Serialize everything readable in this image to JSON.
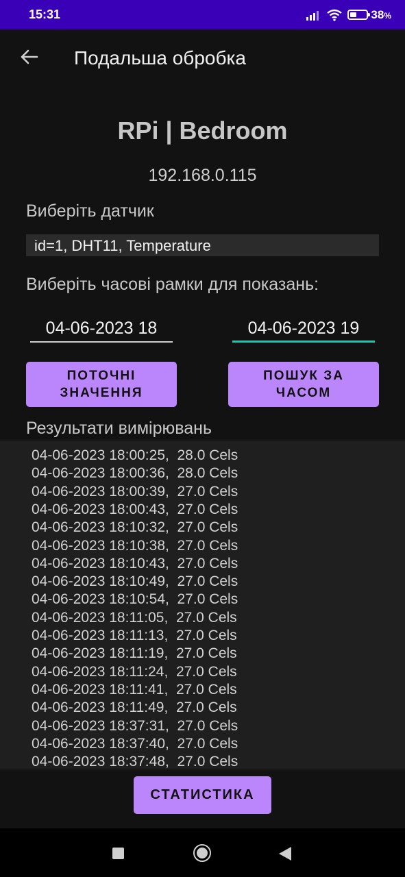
{
  "status_bar": {
    "time": "15:31",
    "battery_percent": "38",
    "battery_unit": "%",
    "battery_level": 0.38,
    "icons": [
      "signal-icon",
      "wifi-icon",
      "battery-icon"
    ]
  },
  "toolbar": {
    "back_icon": "arrow-left-icon",
    "title": "Подальша обробка"
  },
  "device": {
    "name": "RPi | Bedroom",
    "ip": "192.168.0.115"
  },
  "sensor": {
    "label": "Виберіть датчик",
    "selected": "id=1, DHT11, Temperature"
  },
  "timeframe": {
    "label": "Виберіть часові рамки для показань:",
    "from": "04-06-2023 18",
    "to": "04-06-2023 19"
  },
  "buttons": {
    "current_line1": "ПОТОЧНІ",
    "current_line2": "ЗНАЧЕННЯ",
    "search_line1": "ПОШУК ЗА",
    "search_line2": "ЧАСОМ",
    "stats": "СТАТИСТИКА"
  },
  "results": {
    "label": "Результати вимірювань",
    "rows": [
      "04-06-2023 18:00:25,  28.0 Cels",
      "04-06-2023 18:00:36,  28.0 Cels",
      "04-06-2023 18:00:39,  27.0 Cels",
      "04-06-2023 18:00:43,  27.0 Cels",
      "04-06-2023 18:10:32,  27.0 Cels",
      "04-06-2023 18:10:38,  27.0 Cels",
      "04-06-2023 18:10:43,  27.0 Cels",
      "04-06-2023 18:10:49,  27.0 Cels",
      "04-06-2023 18:10:54,  27.0 Cels",
      "04-06-2023 18:11:05,  27.0 Cels",
      "04-06-2023 18:11:13,  27.0 Cels",
      "04-06-2023 18:11:19,  27.0 Cels",
      "04-06-2023 18:11:24,  27.0 Cels",
      "04-06-2023 18:11:41,  27.0 Cels",
      "04-06-2023 18:11:49,  27.0 Cels",
      "04-06-2023 18:37:31,  27.0 Cels",
      "04-06-2023 18:37:40,  27.0 Cels",
      "04-06-2023 18:37:48,  27.0 Cels"
    ]
  },
  "nav_bar": {
    "icons": [
      "recents-square-icon",
      "home-circle-icon",
      "back-triangle-icon"
    ]
  },
  "colors": {
    "status_bar": "#3a00b8",
    "background": "#121212",
    "button": "#bb86fc",
    "input_accent": "#1ec7b4"
  }
}
